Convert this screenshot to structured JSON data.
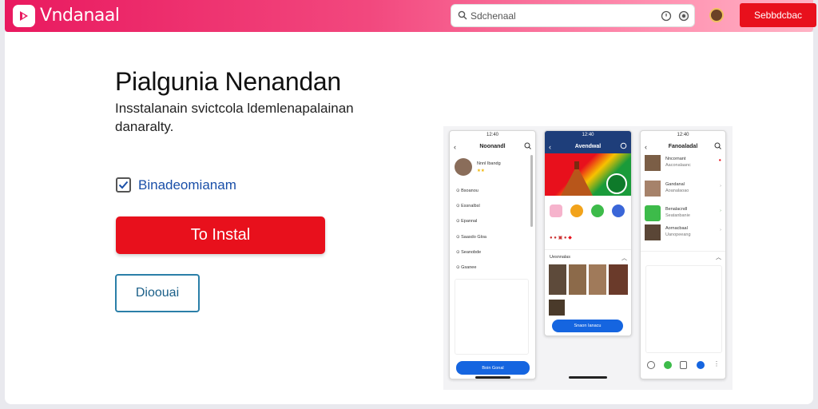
{
  "header": {
    "brand": "Vndanaal",
    "search_placeholder": "Sdchenaal",
    "signin_label": "Sebbdcbac",
    "accent": "#e9195f"
  },
  "hero": {
    "title": "Pialgunia Nenandan",
    "description": "Insstalanain svictcola ldemlenapalainan danaralty.",
    "checkbox_label": "Binadeomianam",
    "checkbox_checked": true,
    "install_label": "To Instal",
    "download_label": "Dioouai",
    "install_color": "#e8101c"
  },
  "phone1": {
    "status": "12:40",
    "title": "Noonandl",
    "profile_name": "Nnnl Ibandg",
    "menu": [
      "Bsoanou",
      "Essnalbsl",
      "Epannal",
      "Saasdo Gloa",
      "Seanobde",
      "Gsanee"
    ],
    "button": "Boin Gonal"
  },
  "phone2": {
    "status": "12:40",
    "title": "Avendwal",
    "section": "Uesnnalas",
    "button": "Snaon Ianacu",
    "icons": [
      "gallery-icon",
      "star-icon",
      "leaf-icon",
      "chat-icon"
    ]
  },
  "phone3": {
    "status": "12:40",
    "title": "Fanoaladal",
    "rows": [
      {
        "title": "Nncornant",
        "sub": "Aaconalaanc"
      },
      {
        "title": "Gandanal",
        "sub": "Aoanalaoao"
      },
      {
        "title": "Benalacndl",
        "sub": "Seatanbanie"
      },
      {
        "title": "Aornacbaal",
        "sub": "Uanopeeang"
      }
    ]
  }
}
